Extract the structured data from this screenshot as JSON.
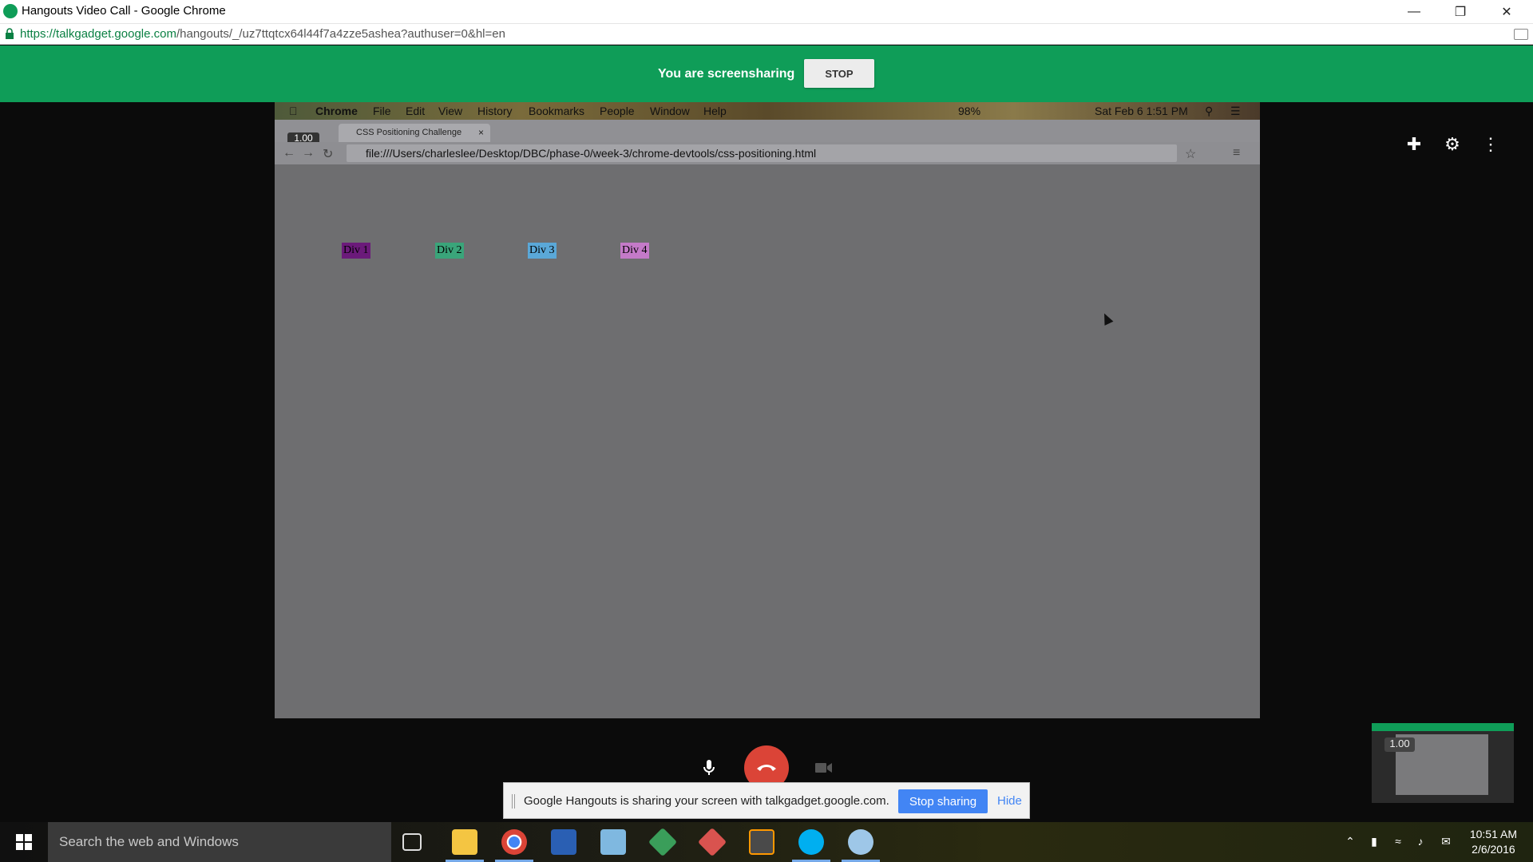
{
  "window": {
    "title": "Hangouts Video Call - Google Chrome",
    "url_host": "https://talkgadget.google.com",
    "url_path": "/hangouts/_/uz7ttqtcx64l44f7a4zze5ashea?authuser=0&hl=en"
  },
  "banner": {
    "message": "You are screensharing",
    "stop_label": "STOP"
  },
  "shared_screen": {
    "mac_menu": [
      "Chrome",
      "File",
      "Edit",
      "View",
      "History",
      "Bookmarks",
      "People",
      "Window",
      "Help"
    ],
    "mac_clock": "Sat Feb 6  1:51 PM",
    "mac_battery": "98%",
    "zoom_badge": "1.00",
    "tab_title": "CSS Positioning Challenge",
    "tab_close": "×",
    "url": "file:///Users/charleslee/Desktop/DBC/phase-0/week-3/chrome-devtools/css-positioning.html",
    "divs": [
      {
        "label": "Div 1",
        "bg": "#6b1a7a"
      },
      {
        "label": "Div 2",
        "bg": "#3aa57a"
      },
      {
        "label": "Div 3",
        "bg": "#5aa8d8"
      },
      {
        "label": "Div 4",
        "bg": "#c47ac8"
      }
    ]
  },
  "self_view": {
    "zoom_badge": "1.00"
  },
  "share_notice": {
    "message": "Google Hangouts is sharing your screen with talkgadget.google.com.",
    "stop_label": "Stop sharing",
    "hide_label": "Hide"
  },
  "taskbar": {
    "search_placeholder": "Search the web and Windows",
    "time": "10:51 AM",
    "date": "2/6/2016"
  },
  "colors": {
    "hangouts_green": "#0f9d58",
    "hangup_red": "#db4437",
    "blue": "#4285f4"
  }
}
